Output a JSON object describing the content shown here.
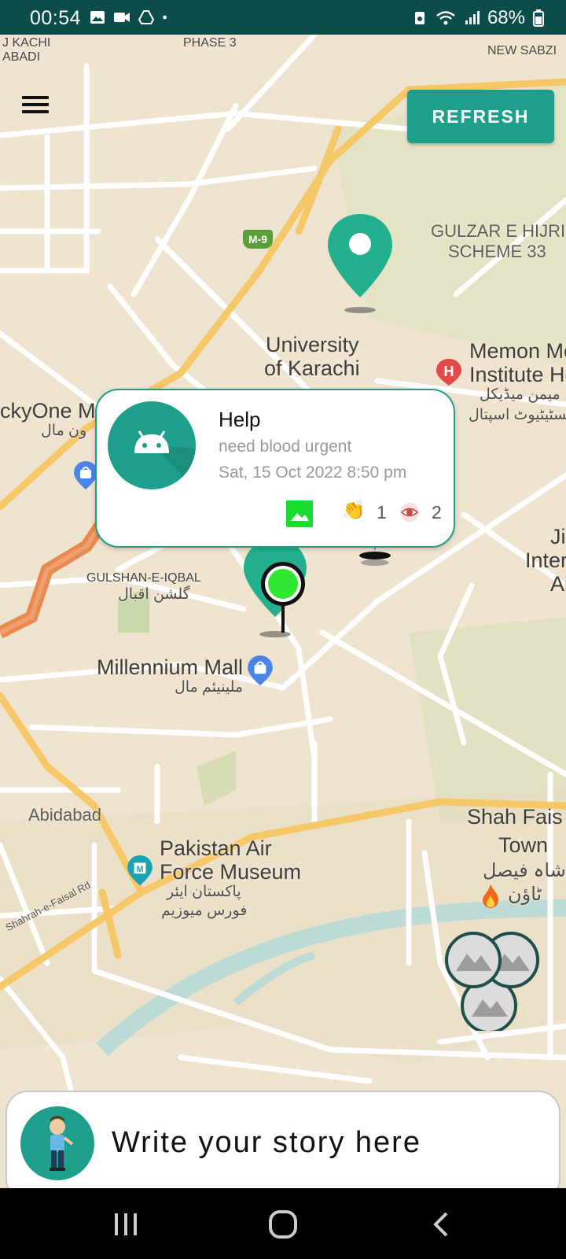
{
  "status_bar": {
    "time": "00:54",
    "battery": "68%"
  },
  "controls": {
    "refresh_label": "REFRESH"
  },
  "map_labels": {
    "kachi_abadi": "J KACHI\nABADI",
    "phase3": "PHASE 3",
    "new_sabzi": "NEW SABZI",
    "m9": "M-9",
    "gulzar": "GULZAR E HIJRI",
    "gulzar2": "SCHEME 33",
    "university": "University",
    "university2": "of Karachi",
    "memon": "Memon Me",
    "memon2": "Institute Ho",
    "memon_urdu": "میمن میڈیکل",
    "memon_urdu2": "انسٹیٹیوٹ اسپتال",
    "lucky": "ckyOne Ma",
    "lucky_urdu": "ون مال",
    "gulshan": "GULSHAN-E-IQBAL",
    "gulshan_urdu": "گلشن اقبال",
    "jinnah": "Ji",
    "jinnah2": "Inter",
    "jinnah3": "Ai",
    "millennium": "Millennium Mall",
    "millennium_urdu": "ملینیئم مال",
    "abidabad": "Abidabad",
    "paf": "Pakistan Air",
    "paf2": "Force Museum",
    "paf_urdu": "پاکستان ایئر",
    "paf_urdu2": "فورس میوزیم",
    "shah_faisal": "Shah Fais",
    "shah_faisal2": "Town",
    "shah_faisal_urdu": "شاہ فیصل",
    "shah_faisal_urdu2": "ٹاؤن",
    "shahrah": "Shahrah-e-Faisal Rd"
  },
  "popup": {
    "title": "Help",
    "description": "need blood urgent",
    "date": "Sat, 15 Oct 2022 8:50 pm",
    "claps": "1",
    "views": "2"
  },
  "story_bar": {
    "prompt": "Write your story here"
  },
  "colors": {
    "accent": "#1e9f8c",
    "status_bar": "#0a4d4a",
    "map_bg": "#efe4cf",
    "road_major": "#f6c766",
    "road_minor": "#ffffff"
  }
}
